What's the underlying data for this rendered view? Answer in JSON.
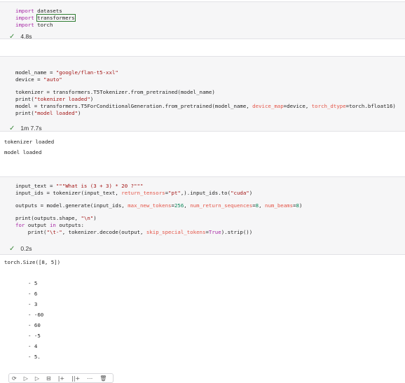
{
  "cell1": {
    "lines": [
      [
        {
          "t": "import ",
          "c": "kw"
        },
        {
          "t": "datasets",
          "c": "fn"
        }
      ],
      [
        {
          "t": "import ",
          "c": "kw"
        },
        {
          "t": "transformers",
          "c": "fn hl"
        }
      ],
      [
        {
          "t": "import ",
          "c": "kw"
        },
        {
          "t": "torch",
          "c": "fn"
        }
      ]
    ],
    "status": "4.8s"
  },
  "cell2": {
    "lines": [
      [
        {
          "t": "model_name = ",
          "c": "fn"
        },
        {
          "t": "\"google/flan-t5-xxl\"",
          "c": "str"
        }
      ],
      [
        {
          "t": "device = ",
          "c": "fn"
        },
        {
          "t": "\"auto\"",
          "c": "str"
        }
      ],
      [],
      [
        {
          "t": "tokenizer = transformers.T5Tokenizer.from_pretrained(model_name)",
          "c": "fn"
        }
      ],
      [
        {
          "t": "print(",
          "c": "fn"
        },
        {
          "t": "\"tokenizer loaded\"",
          "c": "str"
        },
        {
          "t": ")",
          "c": "fn"
        }
      ],
      [
        {
          "t": "model = transformers.T5ForConditionalGeneration.from_pretrained(model_name, ",
          "c": "fn"
        },
        {
          "t": "device_map",
          "c": "param"
        },
        {
          "t": "=device, ",
          "c": "fn"
        },
        {
          "t": "torch_dtype",
          "c": "param"
        },
        {
          "t": "=torch.bfloat16)",
          "c": "fn"
        }
      ],
      [
        {
          "t": "print(",
          "c": "fn"
        },
        {
          "t": "\"model loaded\"",
          "c": "str"
        },
        {
          "t": ")",
          "c": "fn"
        }
      ]
    ],
    "status": "1m 7.7s",
    "output": [
      "tokenizer loaded",
      "model loaded"
    ]
  },
  "cell3": {
    "lines": [
      [
        {
          "t": "input_text = ",
          "c": "fn"
        },
        {
          "t": "\"\"\"What is (3 + 3) * 20 ?\"\"\"",
          "c": "str"
        }
      ],
      [
        {
          "t": "input_ids = tokenizer(input_text, ",
          "c": "fn"
        },
        {
          "t": "return_tensors",
          "c": "param"
        },
        {
          "t": "=",
          "c": "fn"
        },
        {
          "t": "\"pt\"",
          "c": "str"
        },
        {
          "t": ",).input_ids.to(",
          "c": "fn"
        },
        {
          "t": "\"cuda\"",
          "c": "str"
        },
        {
          "t": ")",
          "c": "fn"
        }
      ],
      [],
      [
        {
          "t": "outputs = model.generate(input_ids, ",
          "c": "fn"
        },
        {
          "t": "max_new_tokens",
          "c": "param"
        },
        {
          "t": "=",
          "c": "fn"
        },
        {
          "t": "256",
          "c": "num"
        },
        {
          "t": ", ",
          "c": "fn"
        },
        {
          "t": "num_return_sequences",
          "c": "param"
        },
        {
          "t": "=",
          "c": "fn"
        },
        {
          "t": "8",
          "c": "num"
        },
        {
          "t": ", ",
          "c": "fn"
        },
        {
          "t": "num_beams",
          "c": "param"
        },
        {
          "t": "=",
          "c": "fn"
        },
        {
          "t": "8",
          "c": "num"
        },
        {
          "t": ")",
          "c": "fn"
        }
      ],
      [],
      [
        {
          "t": "print(outputs.shape, ",
          "c": "fn"
        },
        {
          "t": "\"\\n\"",
          "c": "str"
        },
        {
          "t": ")",
          "c": "fn"
        }
      ],
      [
        {
          "t": "for ",
          "c": "kw"
        },
        {
          "t": "output ",
          "c": "fn"
        },
        {
          "t": "in ",
          "c": "kw"
        },
        {
          "t": "outputs:",
          "c": "fn"
        }
      ],
      [
        {
          "t": "    print(",
          "c": "fn"
        },
        {
          "t": "\"\\t-\"",
          "c": "str"
        },
        {
          "t": ", tokenizer.decode(output, ",
          "c": "fn"
        },
        {
          "t": "skip_special_tokens",
          "c": "param"
        },
        {
          "t": "=",
          "c": "fn"
        },
        {
          "t": "True",
          "c": "kw"
        },
        {
          "t": ").strip())",
          "c": "fn"
        }
      ]
    ],
    "status": "0.2s",
    "output_shape": "torch.Size([8, 5])",
    "output_items": [
      "- 5",
      "- 6",
      "- 3",
      "- -60",
      "- 60",
      "- -5",
      "- 4",
      "- 5."
    ]
  },
  "toolbar": {
    "icons": [
      "run-by-line-icon",
      "execute-above-icon",
      "execute-below-icon",
      "split-cell-icon",
      "insert-above-icon",
      "insert-below-icon",
      "more-icon",
      "delete-icon"
    ],
    "glyphs": [
      "⟳",
      "▷",
      "▷",
      "⊟",
      "|+",
      "||+",
      "⋯",
      "🗑"
    ]
  }
}
